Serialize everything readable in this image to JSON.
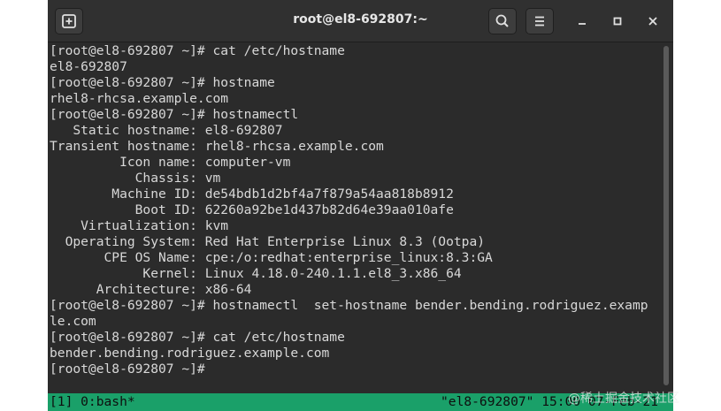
{
  "window": {
    "title": "root@el8-692807:~"
  },
  "terminal": {
    "lines": [
      "[root@el8-692807 ~]# cat /etc/hostname",
      "el8-692807",
      "[root@el8-692807 ~]# hostname",
      "rhel8-rhcsa.example.com",
      "[root@el8-692807 ~]# hostnamectl",
      "   Static hostname: el8-692807",
      "Transient hostname: rhel8-rhcsa.example.com",
      "         Icon name: computer-vm",
      "           Chassis: vm",
      "        Machine ID: de54bdb1d2bf4a7f879a54aa818b8912",
      "           Boot ID: 62260a92be1d437b82d64e39aa010afe",
      "    Virtualization: kvm",
      "  Operating System: Red Hat Enterprise Linux 8.3 (Ootpa)",
      "       CPE OS Name: cpe:/o:redhat:enterprise_linux:8.3:GA",
      "            Kernel: Linux 4.18.0-240.1.1.el8_3.x86_64",
      "      Architecture: x86-64",
      "[root@el8-692807 ~]# hostnamectl  set-hostname bender.bending.rodriguez.examp",
      "le.com",
      "[root@el8-692807 ~]# cat /etc/hostname",
      "bender.bending.rodriguez.example.com",
      "[root@el8-692807 ~]#"
    ]
  },
  "statusbar": {
    "left": "[1] 0:bash*",
    "right": "\"el8-692807\" 15:00 07-Feb-21"
  },
  "watermark": "@稀土掘金技术社区",
  "icons": {
    "new_tab": "new-tab-icon",
    "search": "search-icon",
    "menu": "hamburger-menu-icon",
    "minimize": "minimize-icon",
    "maximize": "maximize-icon",
    "close": "close-icon"
  },
  "colors": {
    "terminal_bg": "#2b2b2b",
    "terminal_fg": "#d8d8d8",
    "statusbar_bg": "#1aa069"
  }
}
